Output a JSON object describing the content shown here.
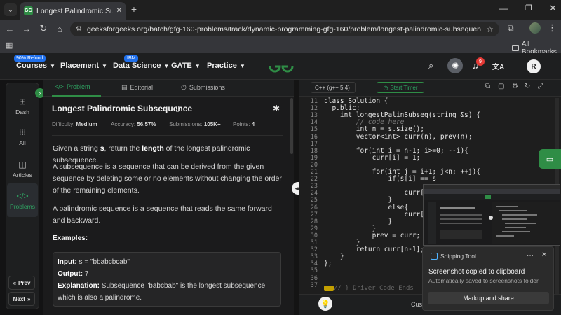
{
  "browser": {
    "tab_title": "Longest Palindromic Subseque",
    "favicon_text": "GG",
    "url": "geeksforgeeks.org/batch/gfg-160-problems/track/dynamic-programming-gfg-160/problem/longest-palindromic-subsequence-1612327...",
    "all_bookmarks": "All Bookmarks"
  },
  "header": {
    "menu": [
      {
        "label": "Courses",
        "badge": "90% Refund"
      },
      {
        "label": "Placement"
      },
      {
        "label": "Data Science",
        "badge": "IBM"
      },
      {
        "label": "GATE"
      },
      {
        "label": "Practice"
      }
    ],
    "notification_count": "9",
    "avatar_letter": "R"
  },
  "rail": {
    "items": [
      "Dash",
      "All",
      "Articles",
      "Problems"
    ],
    "prev": "Prev",
    "next": "Next"
  },
  "problem": {
    "tabs": [
      "Problem",
      "Editorial",
      "Submissions"
    ],
    "title": "Longest Palindromic Subsequence",
    "meta": {
      "difficulty_label": "Difficulty:",
      "difficulty": "Medium",
      "accuracy_label": "Accuracy:",
      "accuracy": "56.57%",
      "submissions_label": "Submissions:",
      "submissions": "105K+",
      "points_label": "Points:",
      "points": "4"
    },
    "p1_a": "Given a string ",
    "p1_s": "s",
    "p1_b": ", return the ",
    "p1_len": "length",
    "p1_c": " of the longest palindromic subsequence.",
    "p2": "A subsequence is a sequence that can be derived from the given sequence by deleting some or no elements without changing the order of the remaining elements.",
    "p3": "A palindromic sequence is a sequence that reads the same forward and backward.",
    "examples_label": "Examples:",
    "example": {
      "input_label": "Input:",
      "input": " s = \"bbabcbcab\"",
      "output_label": "Output:",
      "output": " 7",
      "explanation_label": "Explanation:",
      "explanation": " Subsequence \"babcbab\" is the longest subsequence which is also a palindrome."
    }
  },
  "editor": {
    "language": "C++ (g++ 5.4)",
    "timer": "Start Timer",
    "line_numbers": [
      "11",
      "12",
      "13",
      "14",
      "15",
      "16",
      "17",
      "18",
      "19",
      "20",
      "21",
      "22",
      "23",
      "24",
      "25",
      "26",
      "27",
      "28",
      "29",
      "30",
      "31",
      "32",
      "33",
      "34",
      "35",
      "36",
      "37"
    ],
    "code_lines": [
      "class Solution {",
      "  public:",
      "    int longestPalinSubseq(string &s) {",
      "        // code here",
      "        int n = s.size();",
      "        vector<int> curr(n), prev(n);",
      "",
      "        for(int i = n-1; i>=0; --i){",
      "            curr[i] = 1;",
      "",
      "            for(int j = i+1; j<n; ++j){",
      "                if(s[i] == s",
      "",
      "                    curr[j]",
      "                }",
      "                else{",
      "                    curr[j]",
      "                }",
      "            }",
      "            prev = curr;",
      "        }",
      "        return curr[n-1];",
      "    }",
      "};",
      "",
      "",
      ""
    ],
    "fold_text": "// } Driver Code Ends",
    "bottom_label": "Cust"
  },
  "toast": {
    "app": "Snipping Tool",
    "title": "Screenshot copied to clipboard",
    "subtitle": "Automatically saved to screenshots folder.",
    "button": "Markup and share"
  },
  "colors": {
    "accent": "#2f8d46",
    "badge": "#1f6feb",
    "notification": "#e53935"
  }
}
